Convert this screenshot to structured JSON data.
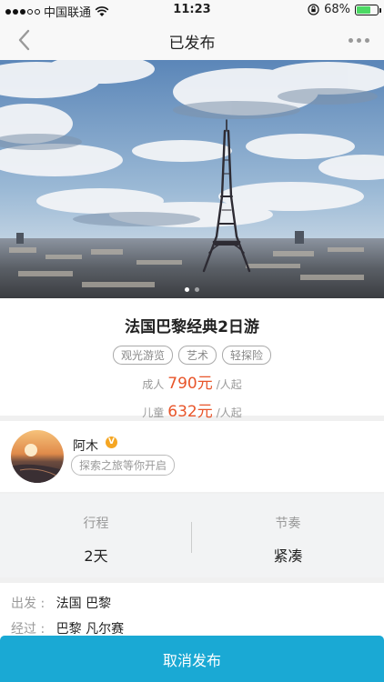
{
  "status_bar": {
    "carrier": "中国联通",
    "time": "11:23",
    "battery_percent": "68%",
    "battery_level": 0.68,
    "icons": [
      "signal-dots",
      "wifi-icon",
      "orientation-lock-icon",
      "battery-icon"
    ]
  },
  "nav": {
    "title": "已发布",
    "back_icon": "chevron-left-icon",
    "more_icon": "more-dots-icon"
  },
  "hero": {
    "image": "eiffel-tower-photo",
    "page_count": 2,
    "active_page": 1
  },
  "trip": {
    "title": "法国巴黎经典2日游",
    "tags": [
      "观光游览",
      "艺术",
      "轻探险"
    ],
    "adult_label": "成人",
    "adult_price": "790元",
    "child_label": "儿童",
    "child_price": "632元",
    "unit": "/人起"
  },
  "host": {
    "name": "阿木",
    "badge": "V",
    "bio": "探索之旅等你开启"
  },
  "stats": {
    "itinerary_label": "行程",
    "itinerary_value": "2天",
    "pace_label": "节奏",
    "pace_value": "紧凑"
  },
  "route": {
    "departure_label": "出发 :",
    "departure_value": "法国 巴黎",
    "via_label": "经过 :",
    "via_value": "巴黎 凡尔赛"
  },
  "actions": {
    "cancel_label": "取消发布"
  },
  "colors": {
    "accent": "#1aa9d4",
    "price": "#e8552a",
    "battery": "#4cd964",
    "badge": "#f5a623"
  }
}
